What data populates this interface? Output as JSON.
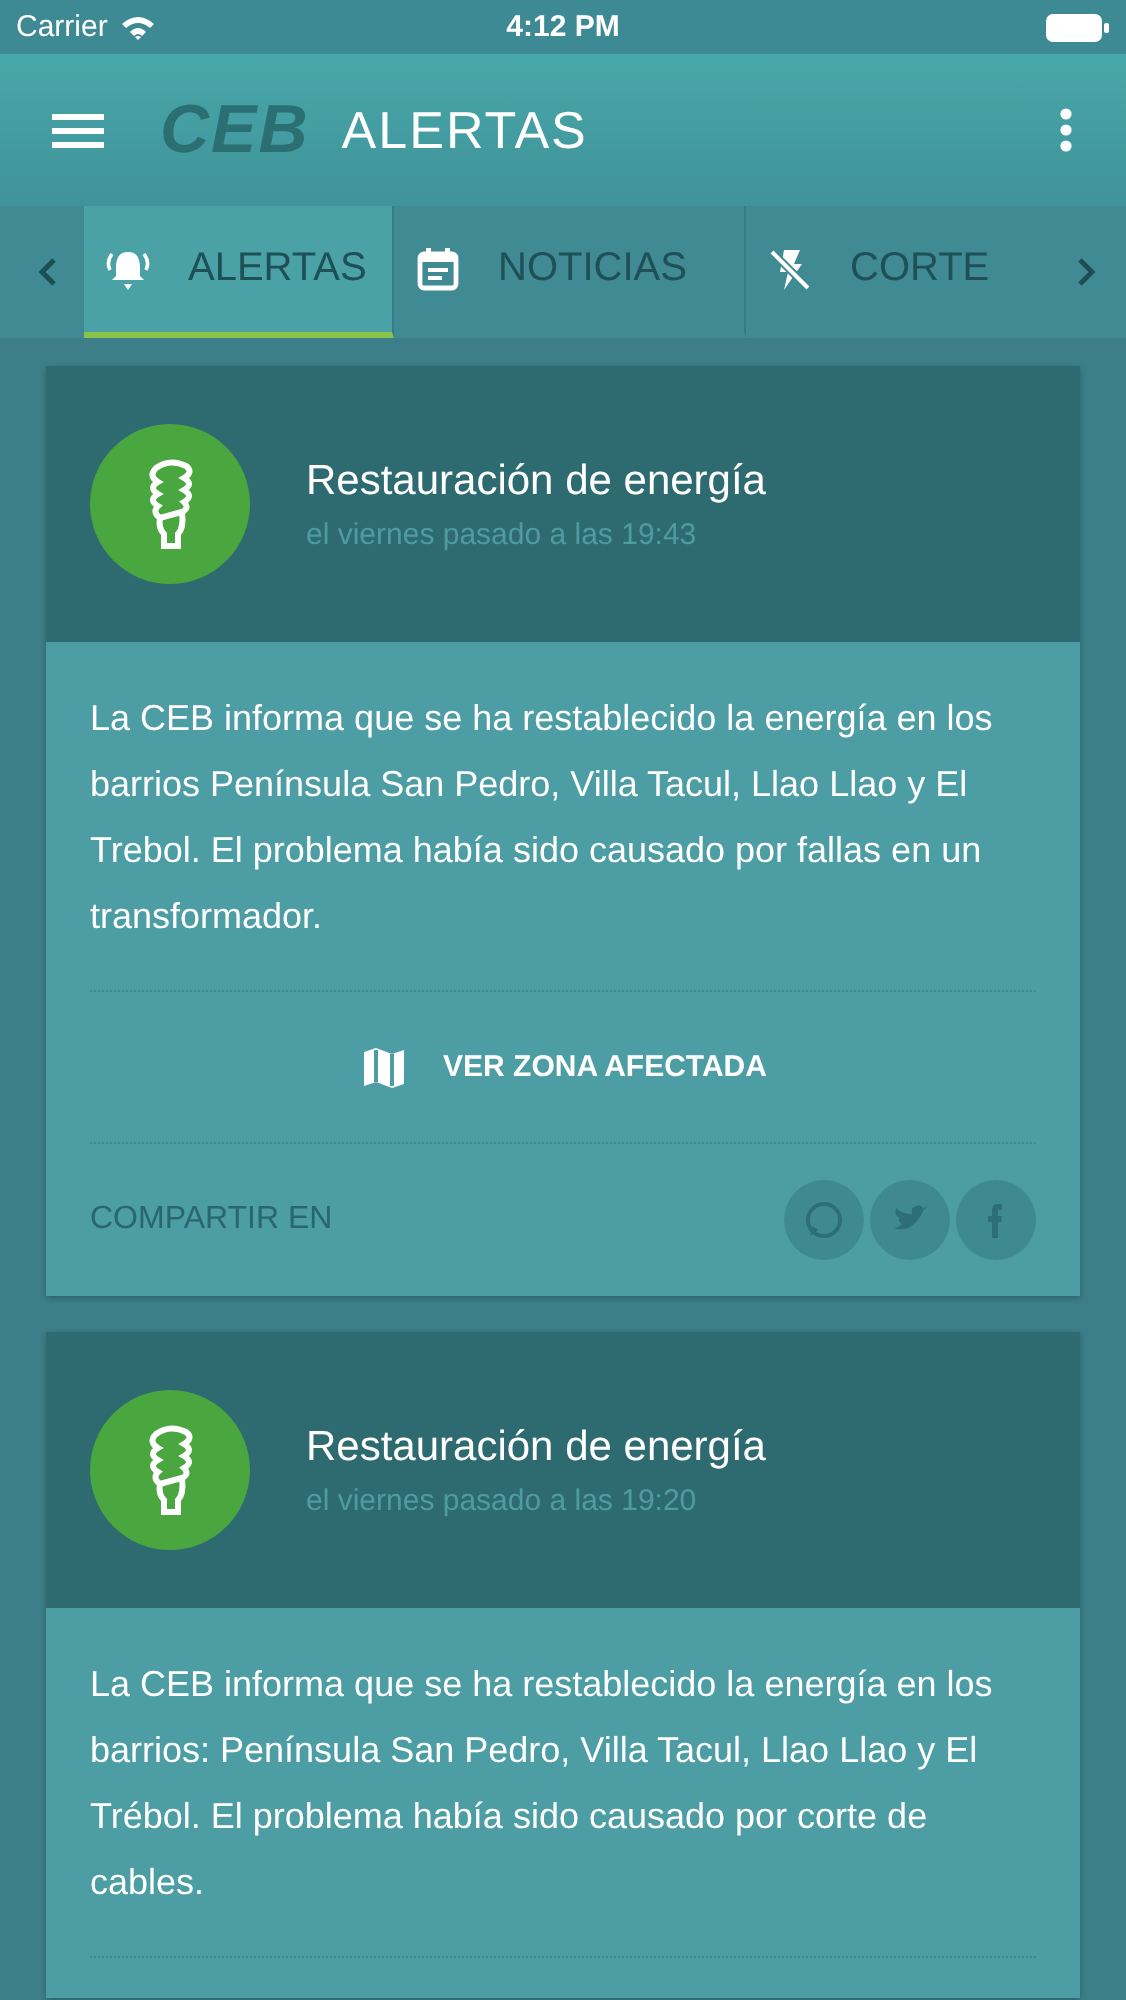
{
  "status_bar": {
    "carrier": "Carrier",
    "time": "4:12 PM"
  },
  "app_bar": {
    "logo": "CEB",
    "title": "ALERTAS"
  },
  "tabs": [
    {
      "label": "ALERTAS",
      "kind": "bell",
      "selected": true
    },
    {
      "label": "NOTICIAS",
      "kind": "calendar",
      "selected": false
    },
    {
      "label": "CORTE",
      "kind": "power-off",
      "selected": false
    }
  ],
  "cards": [
    {
      "title": "Restauración de energía",
      "time": "el viernes pasado a las 19:43",
      "body": "La CEB informa que se ha restablecido la energía en los barrios Península San Pedro, Villa Tacul, Llao Llao y El Trebol. El problema había sido causado por fallas en un transformador.",
      "action": "VER ZONA AFECTADA",
      "share_label": "COMPARTIR EN"
    },
    {
      "title": "Restauración de energía",
      "time": "el viernes pasado a las 19:20",
      "body": "La CEB informa que se ha restablecido la energía en los barrios:  Península San Pedro, Villa Tacul, Llao Llao y El Trébol. El problema había sido causado por corte de cables."
    }
  ]
}
